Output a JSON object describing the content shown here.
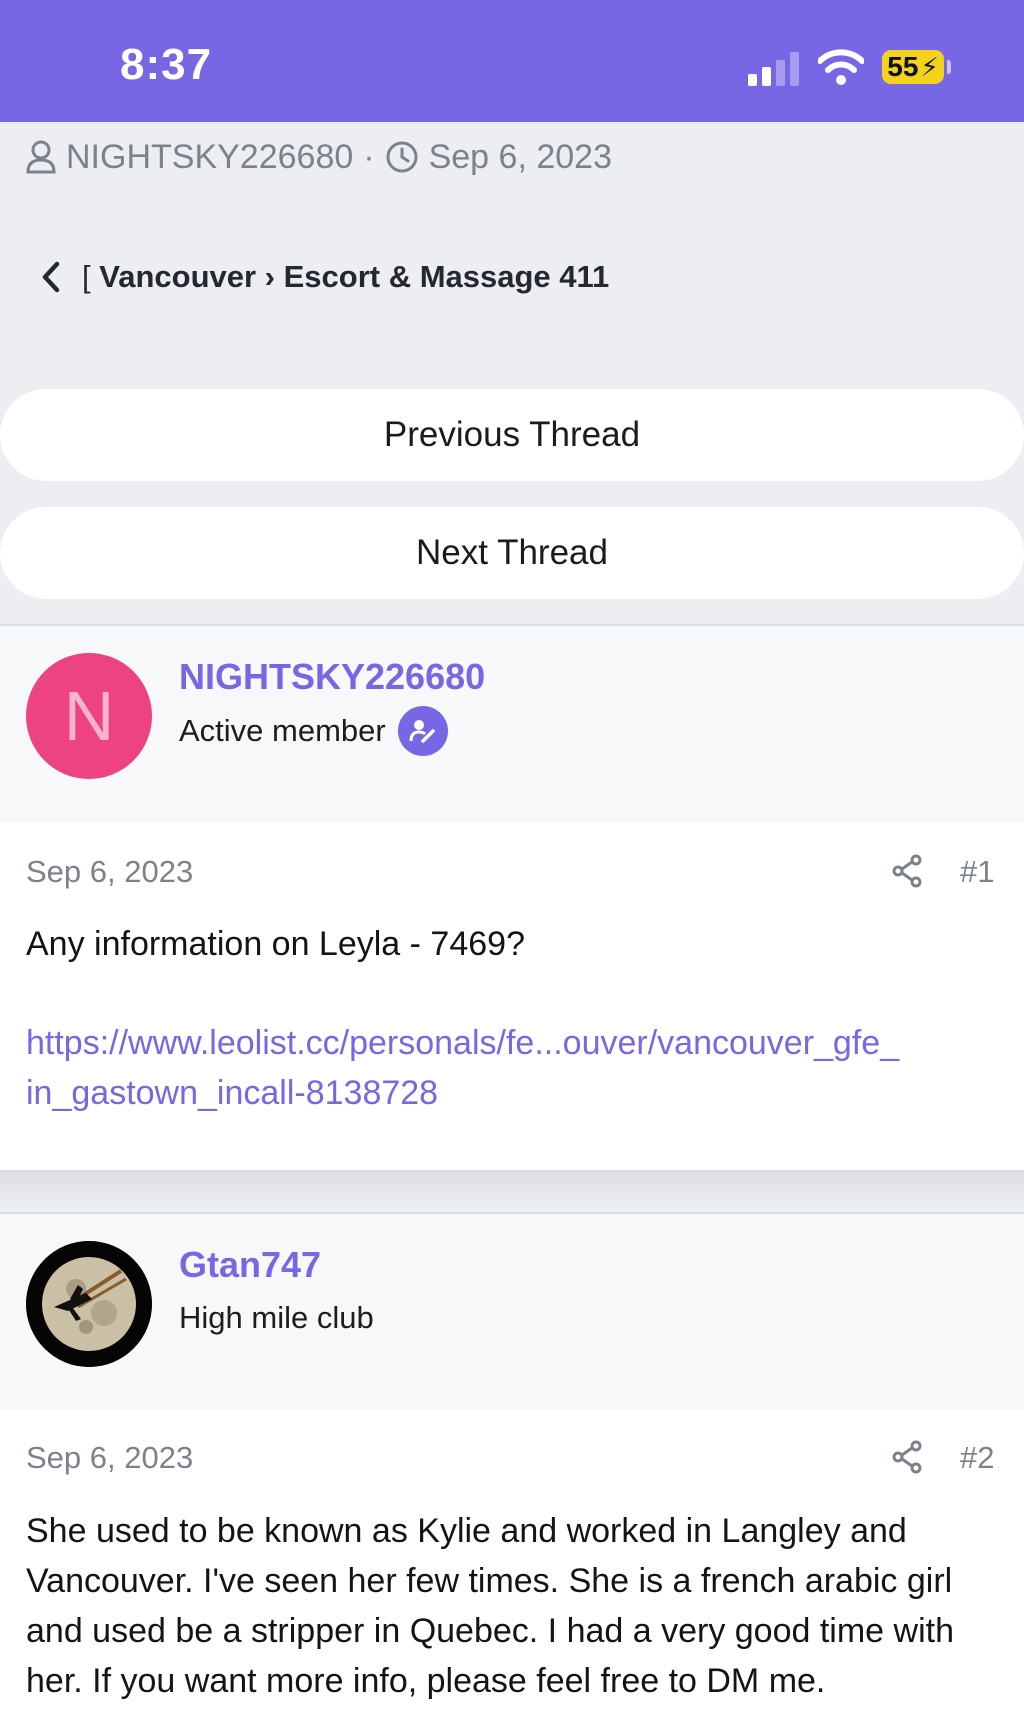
{
  "status_bar": {
    "time": "8:37",
    "battery": "55"
  },
  "thread_meta": {
    "author": "NIGHTSKY226680",
    "separator": "·",
    "date": "Sep 6, 2023"
  },
  "breadcrumb": {
    "prefix": "[",
    "path": "Vancouver › Escort & Massage 411"
  },
  "nav": {
    "previous_label": "Previous Thread",
    "next_label": "Next Thread"
  },
  "posts": [
    {
      "username": "NIGHTSKY226680",
      "avatar_letter": "N",
      "user_title": "Active member",
      "date": "Sep 6, 2023",
      "number": "#1",
      "text": "Any information on Leyla - 7469?",
      "link_line1": "https://www.leolist.cc/personals/fe...ouver/vancouver_gfe_",
      "link_line2": "in_gastown_incall-8138728"
    },
    {
      "username": "Gtan747",
      "user_title": "High mile club",
      "date": "Sep 6, 2023",
      "number": "#2",
      "text": "She used to be known as Kylie and worked in Langley and Vancouver. I've seen her few times. She is a french arabic girl and used be a stripper in Quebec. I had a very good time with her. If you want more info, please feel free to DM me."
    }
  ],
  "colors": {
    "accent": "#7767e4",
    "avatar_pink": "#ed4380",
    "battery": "#f2d21b"
  }
}
